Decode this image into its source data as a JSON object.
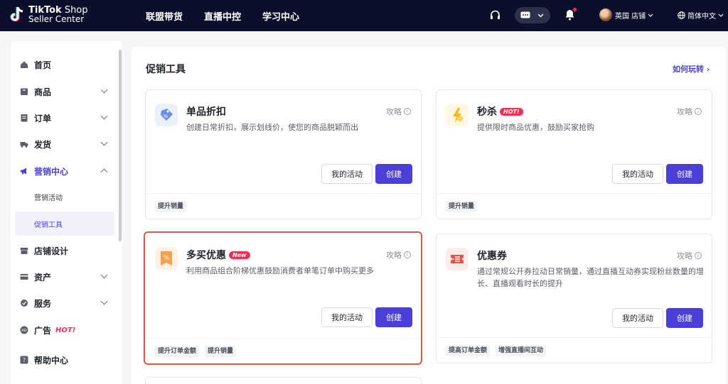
{
  "topbar": {
    "logo_line1_bold": "TikTok",
    "logo_line1_rest": " Shop",
    "logo_line2": "Seller Center",
    "nav": [
      "联盟带货",
      "直播中控",
      "学习中心"
    ],
    "store_label": "英国 店铺",
    "language_label": "简体中文"
  },
  "sidebar": {
    "items": [
      {
        "label": "首页",
        "icon": "home-icon"
      },
      {
        "label": "商品",
        "icon": "product-icon"
      },
      {
        "label": "订单",
        "icon": "order-icon"
      },
      {
        "label": "发货",
        "icon": "truck-icon"
      },
      {
        "label": "营销中心",
        "icon": "megaphone-icon"
      },
      {
        "label": "店铺设计",
        "icon": "store-icon"
      },
      {
        "label": "资产",
        "icon": "card-icon"
      },
      {
        "label": "服务",
        "icon": "service-icon"
      },
      {
        "label": "广告",
        "icon": "ad-icon",
        "hot": "HOT!"
      },
      {
        "label": "帮助中心",
        "icon": "help-icon"
      }
    ],
    "sub_items": [
      "营销活动",
      "促销工具"
    ]
  },
  "main": {
    "title": "促销工具",
    "how_to": "如何玩转",
    "strategy_label": "攻略",
    "my_activity_label": "我的活动",
    "create_label": "创建",
    "cards": [
      {
        "title": "单品折扣",
        "badge": "",
        "desc": "创建日常折扣，展示划线价，使您的商品脱颖而出",
        "tags": [
          "提升销量"
        ],
        "icon": "discount-tag-icon"
      },
      {
        "title": "秒杀",
        "badge": "HOT!",
        "desc": "提供限时商品优惠，鼓励买家抢购",
        "tags": [
          "提升销量"
        ],
        "icon": "flash-icon"
      },
      {
        "title": "多买优惠",
        "badge": "New",
        "desc": "利用商品组合阶梯优惠鼓励消费者单笔订单中购买更多",
        "tags": [
          "提升订单金额",
          "提升销量"
        ],
        "icon": "percent-ribbon-icon"
      },
      {
        "title": "优惠券",
        "badge": "",
        "desc": "通过常规公开券拉动日常销量，通过直播互动券实现粉丝数量的增长、直播观看时长的提升",
        "tags": [
          "提高订单金额",
          "增强直播间互动"
        ],
        "icon": "coupon-icon"
      }
    ]
  },
  "colors": {
    "accent": "#4a3fd9",
    "topbar": "#0c0f2c",
    "hot": "#fe2c55",
    "highlight_border": "#e05545"
  }
}
